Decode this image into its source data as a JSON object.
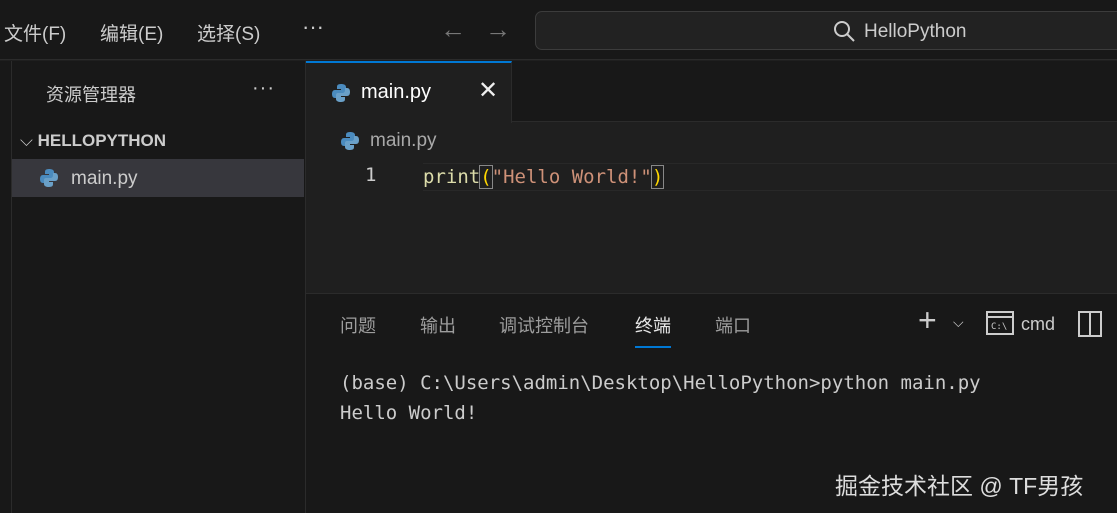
{
  "menu": {
    "file": "文件(F)",
    "edit": "编辑(E)",
    "select": "选择(S)",
    "more": "···"
  },
  "search": {
    "value": "HelloPython"
  },
  "sidebar": {
    "title": "资源管理器",
    "more": "···",
    "folder": "HELLOPYTHON",
    "files": [
      {
        "name": "main.py"
      }
    ]
  },
  "editor": {
    "tab": "main.py",
    "close": "✕",
    "breadcrumb": "main.py",
    "line_number": "1",
    "code": {
      "fn": "print",
      "open": "(",
      "str": "\"Hello World!\"",
      "close": ")"
    }
  },
  "panel": {
    "tabs": [
      "问题",
      "输出",
      "调试控制台",
      "终端",
      "端口"
    ],
    "active": "终端",
    "shell": "cmd",
    "add": "+",
    "terminal": [
      "(base) C:\\Users\\admin\\Desktop\\HelloPython>python main.py",
      "Hello World!"
    ]
  },
  "watermark": "掘金技术社区 @ TF男孩",
  "colors": {
    "accent": "#0078d4",
    "python": "#4b8bbe"
  }
}
